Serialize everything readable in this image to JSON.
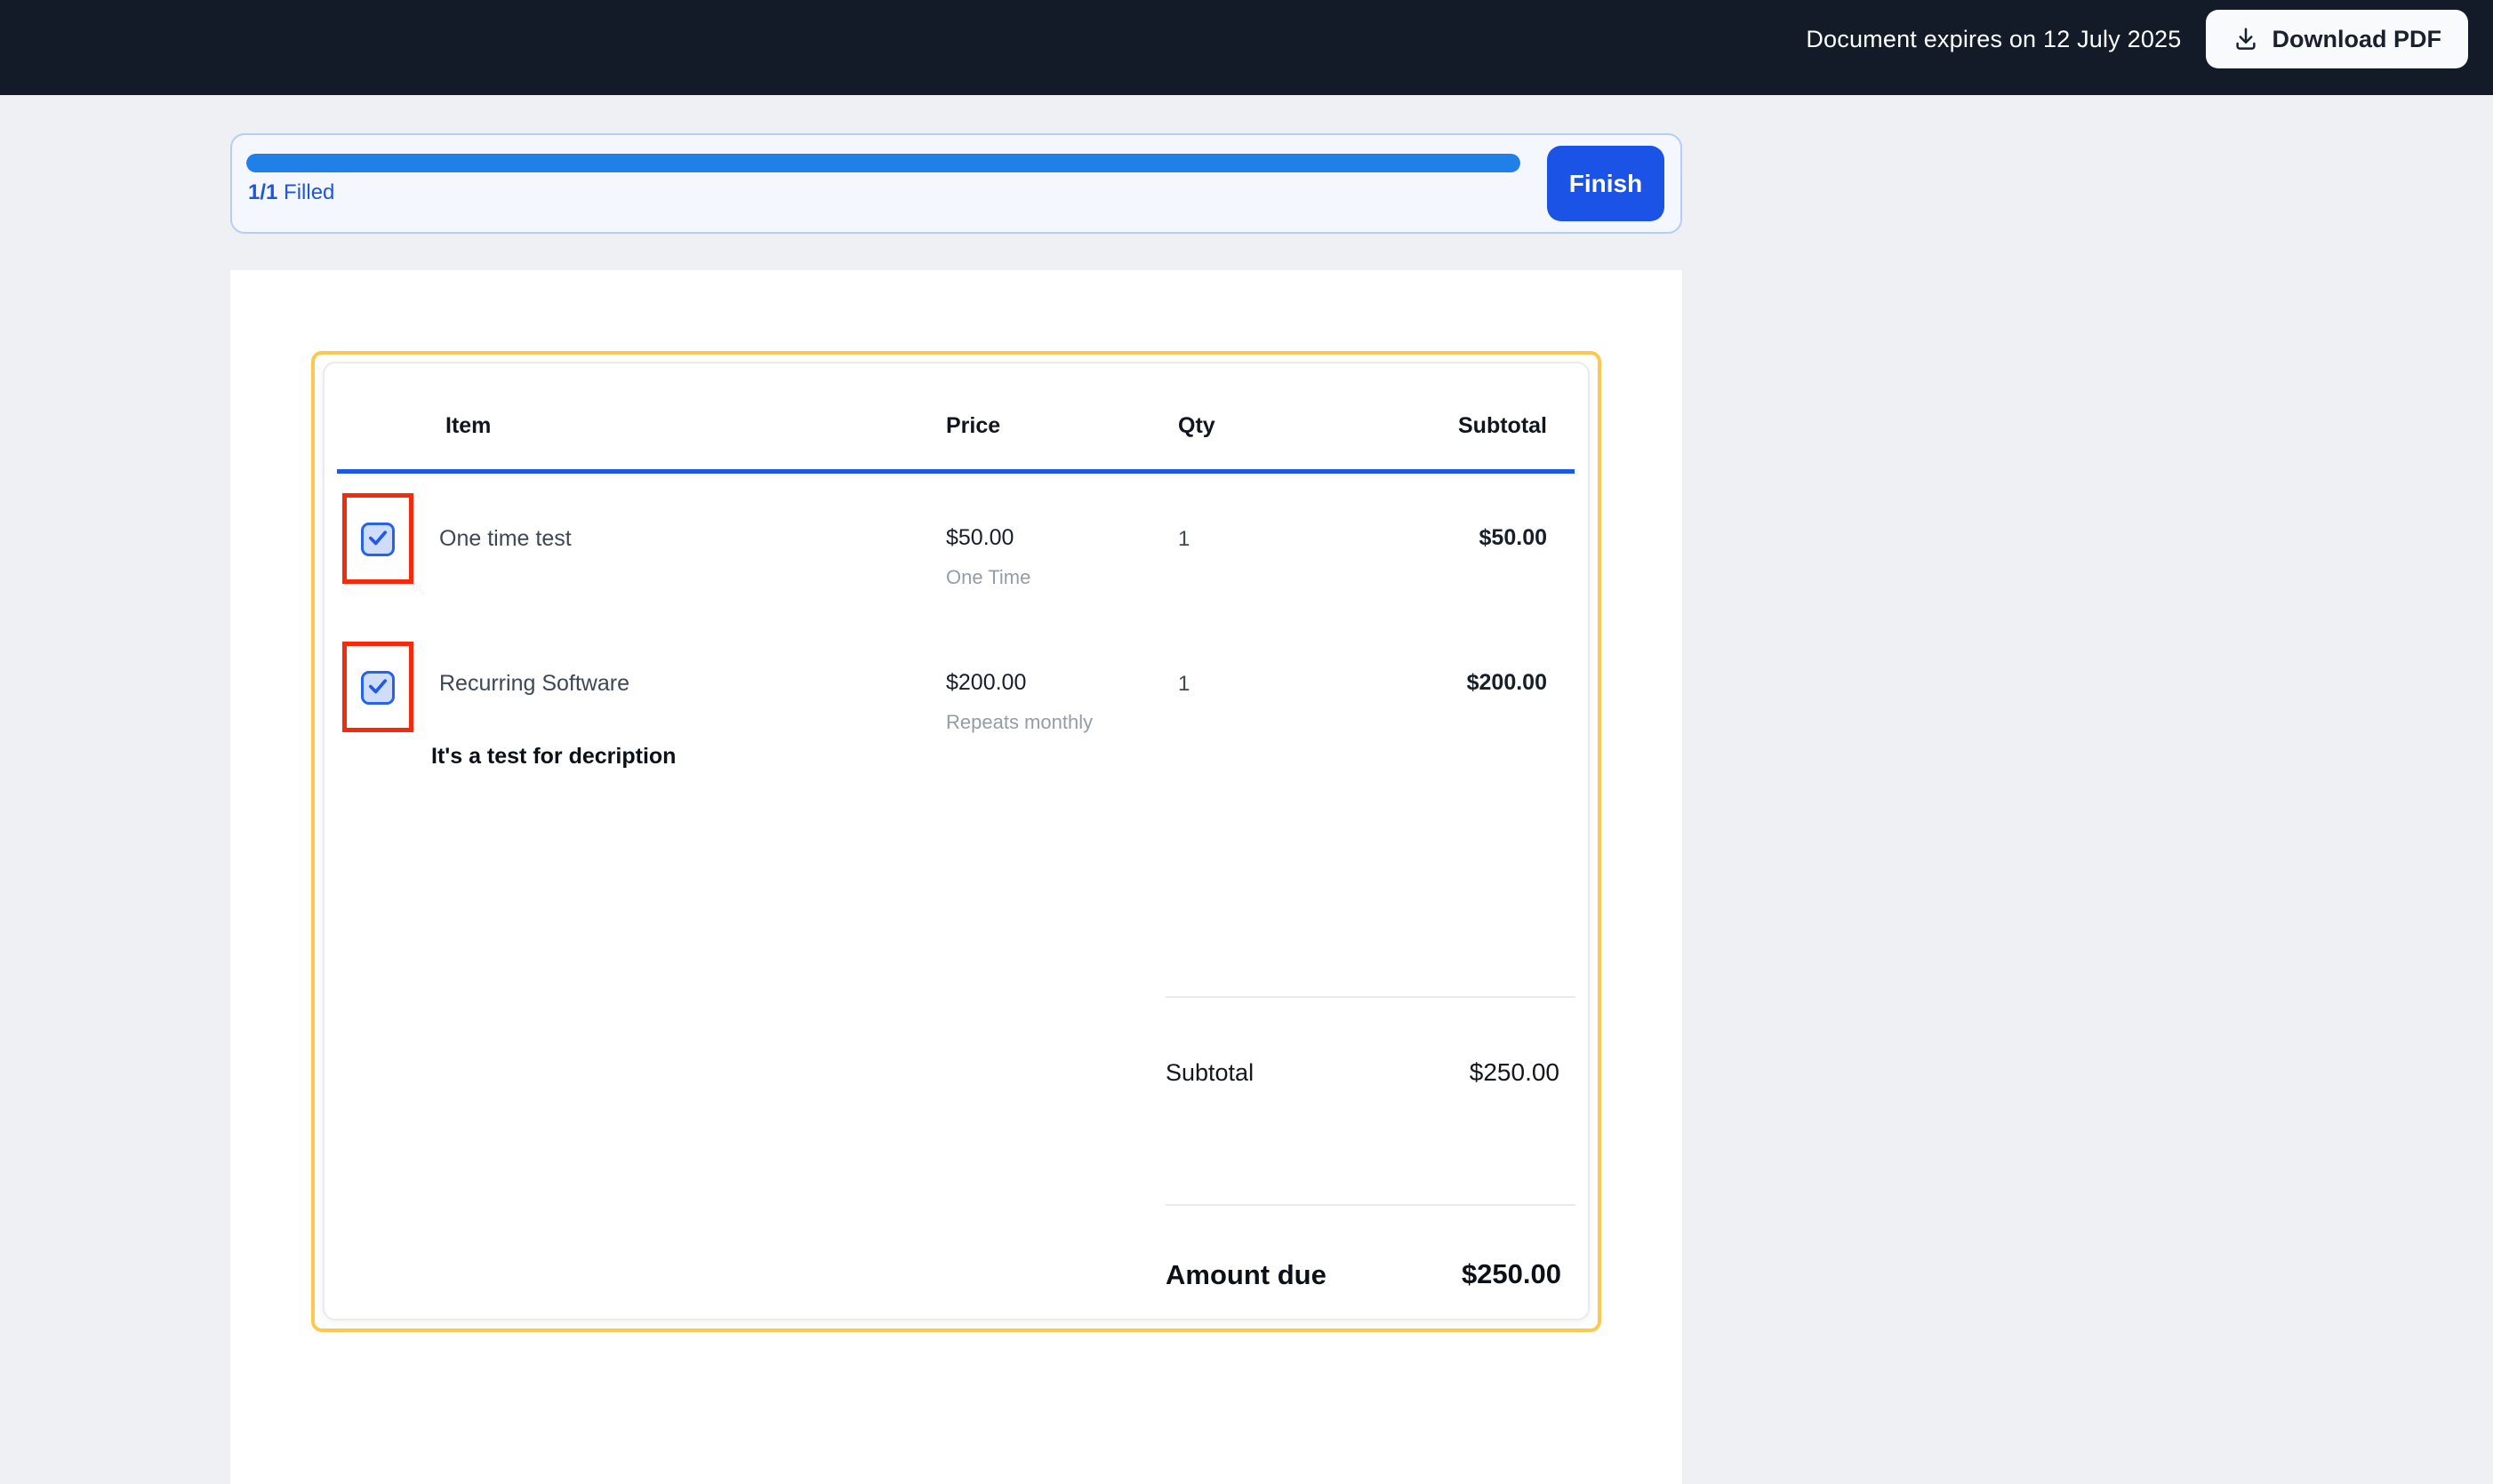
{
  "topbar": {
    "expiry_text": "Document expires on 12 July 2025",
    "download_label": "Download PDF"
  },
  "progress": {
    "count": "1/1",
    "label": "Filled",
    "percent": 100,
    "finish_label": "Finish"
  },
  "pricing_table": {
    "headers": {
      "item": "Item",
      "price": "Price",
      "qty": "Qty",
      "subtotal": "Subtotal"
    },
    "rows": [
      {
        "checked": true,
        "name": "One time test",
        "price": "$50.00",
        "price_note": "One Time",
        "qty": "1",
        "subtotal": "$50.00",
        "description": ""
      },
      {
        "checked": true,
        "name": "Recurring Software",
        "price": "$200.00",
        "price_note": "Repeats monthly",
        "qty": "1",
        "subtotal": "$200.00",
        "description": "It's a test for decription"
      }
    ],
    "totals": {
      "subtotal_label": "Subtotal",
      "subtotal_value": "$250.00",
      "amount_due_label": "Amount due",
      "amount_due_value": "$250.00"
    }
  },
  "colors": {
    "topbar_bg": "#131a28",
    "accent_blue": "#1a53e5",
    "progress_blue": "#2080e8",
    "header_rule_blue": "#1d5ae2",
    "highlight_yellow": "#fcc850",
    "field_red": "#f42a0d",
    "checkbox_blue": "#2563eb"
  }
}
